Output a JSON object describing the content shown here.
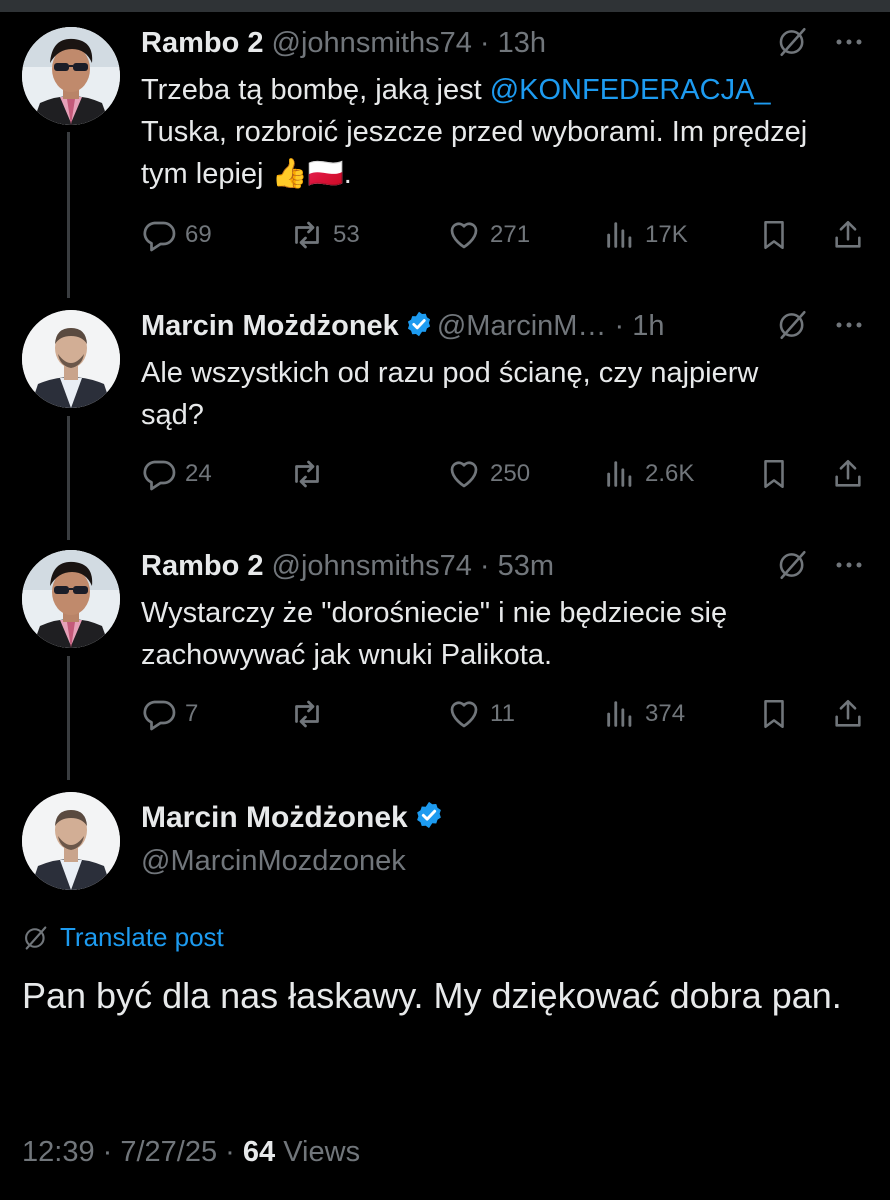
{
  "tweets": [
    {
      "name": "Rambo 2",
      "handle": "@johnsmiths74",
      "time": "13h",
      "verified": false,
      "text_parts": [
        "Trzeba tą bombę, jaką jest ",
        "@KONFEDERACJA_",
        " Tuska, rozbroić jeszcze przed wyborami. Im prędzej tym lepiej 👍🇵🇱."
      ],
      "replies": "69",
      "reposts": "53",
      "likes": "271",
      "views": "17K"
    },
    {
      "name": "Marcin Możdżonek",
      "handle": "@MarcinM…",
      "time": "1h",
      "verified": true,
      "text": "Ale wszystkich od razu pod ścianę, czy najpierw sąd?",
      "replies": "24",
      "reposts": "",
      "likes": "250",
      "views": "2.6K"
    },
    {
      "name": "Rambo 2",
      "handle": "@johnsmiths74",
      "time": "53m",
      "verified": false,
      "text": "Wystarczy że \"dorośniecie\" i nie będziecie się zachowywać jak wnuki Palikota.",
      "replies": "7",
      "reposts": "",
      "likes": "11",
      "views": "374"
    }
  ],
  "main": {
    "name": "Marcin Możdżonek",
    "handle": "@MarcinMozdzonek",
    "translate_label": "Translate post",
    "text": "Pan być dla nas łaskawy. My dziękować dobra pan.",
    "time": "12:39",
    "date": "7/27/25",
    "views_count": "64",
    "views_label": "Views"
  },
  "colors": {
    "accent": "#1d9bf0",
    "muted": "#71767b",
    "text": "#e7e9ea",
    "background": "#000000"
  },
  "icons": [
    "grok-icon",
    "more-icon",
    "reply-icon",
    "repost-icon",
    "like-icon",
    "views-icon",
    "bookmark-icon",
    "share-icon",
    "verified-badge-icon",
    "translate-icon"
  ]
}
